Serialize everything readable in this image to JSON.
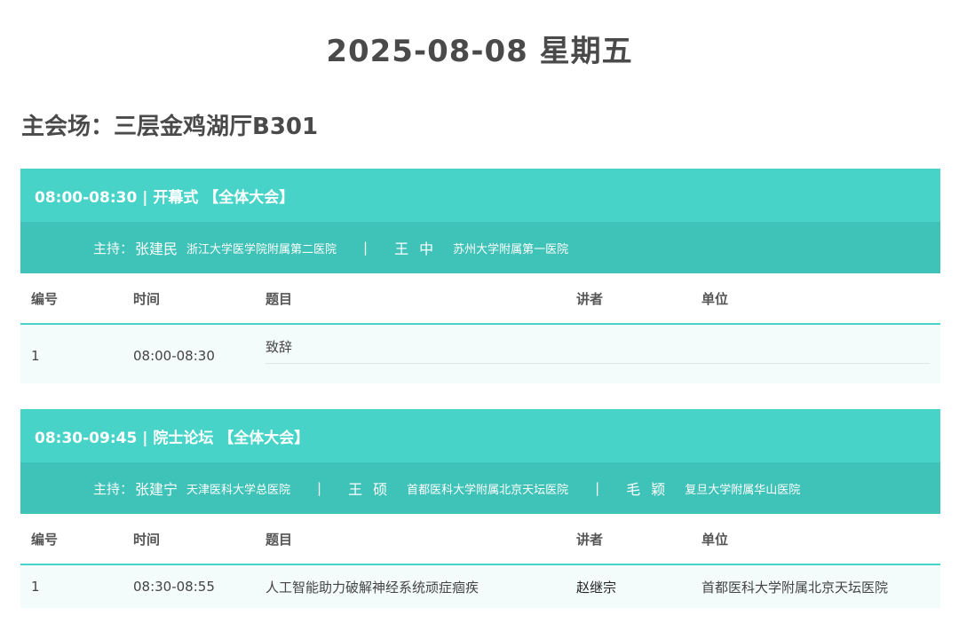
{
  "date_title": "2025-08-08 星期五",
  "venue": "主会场：三层金鸡湖厅B301",
  "table_headers": {
    "no": "编号",
    "time": "时间",
    "topic": "题目",
    "speaker": "讲者",
    "unit": "单位"
  },
  "sessions": [
    {
      "title": "08:00-08:30 | 开幕式 【全体大会】",
      "moderator_label": "主持：",
      "moderators": [
        {
          "name": "张建民",
          "org": "浙江大学医学院附属第二医院"
        },
        {
          "name": "王中",
          "org": "苏州大学附属第一医院"
        }
      ],
      "rows": [
        {
          "no": "1",
          "time": "08:00-08:30",
          "topic": "致辞",
          "speaker": "",
          "unit": ""
        }
      ]
    },
    {
      "title": "08:30-09:45 | 院士论坛 【全体大会】",
      "moderator_label": "主持：",
      "moderators": [
        {
          "name": "张建宁",
          "org": "天津医科大学总医院"
        },
        {
          "name": "王硕",
          "org": "首都医科大学附属北京天坛医院"
        },
        {
          "name": "毛颖",
          "org": "复旦大学附属华山医院"
        }
      ],
      "rows": [
        {
          "no": "1",
          "time": "08:30-08:55",
          "topic": "人工智能助力破解神经系统顽症痼疾",
          "speaker": "赵继宗",
          "unit": "首都医科大学附属北京天坛医院"
        }
      ]
    }
  ],
  "separator": "|",
  "colors": {
    "session_header": "#47d3c8",
    "moderator_bar": "#3fc2b7",
    "row_bg": "#f4fbfb"
  }
}
